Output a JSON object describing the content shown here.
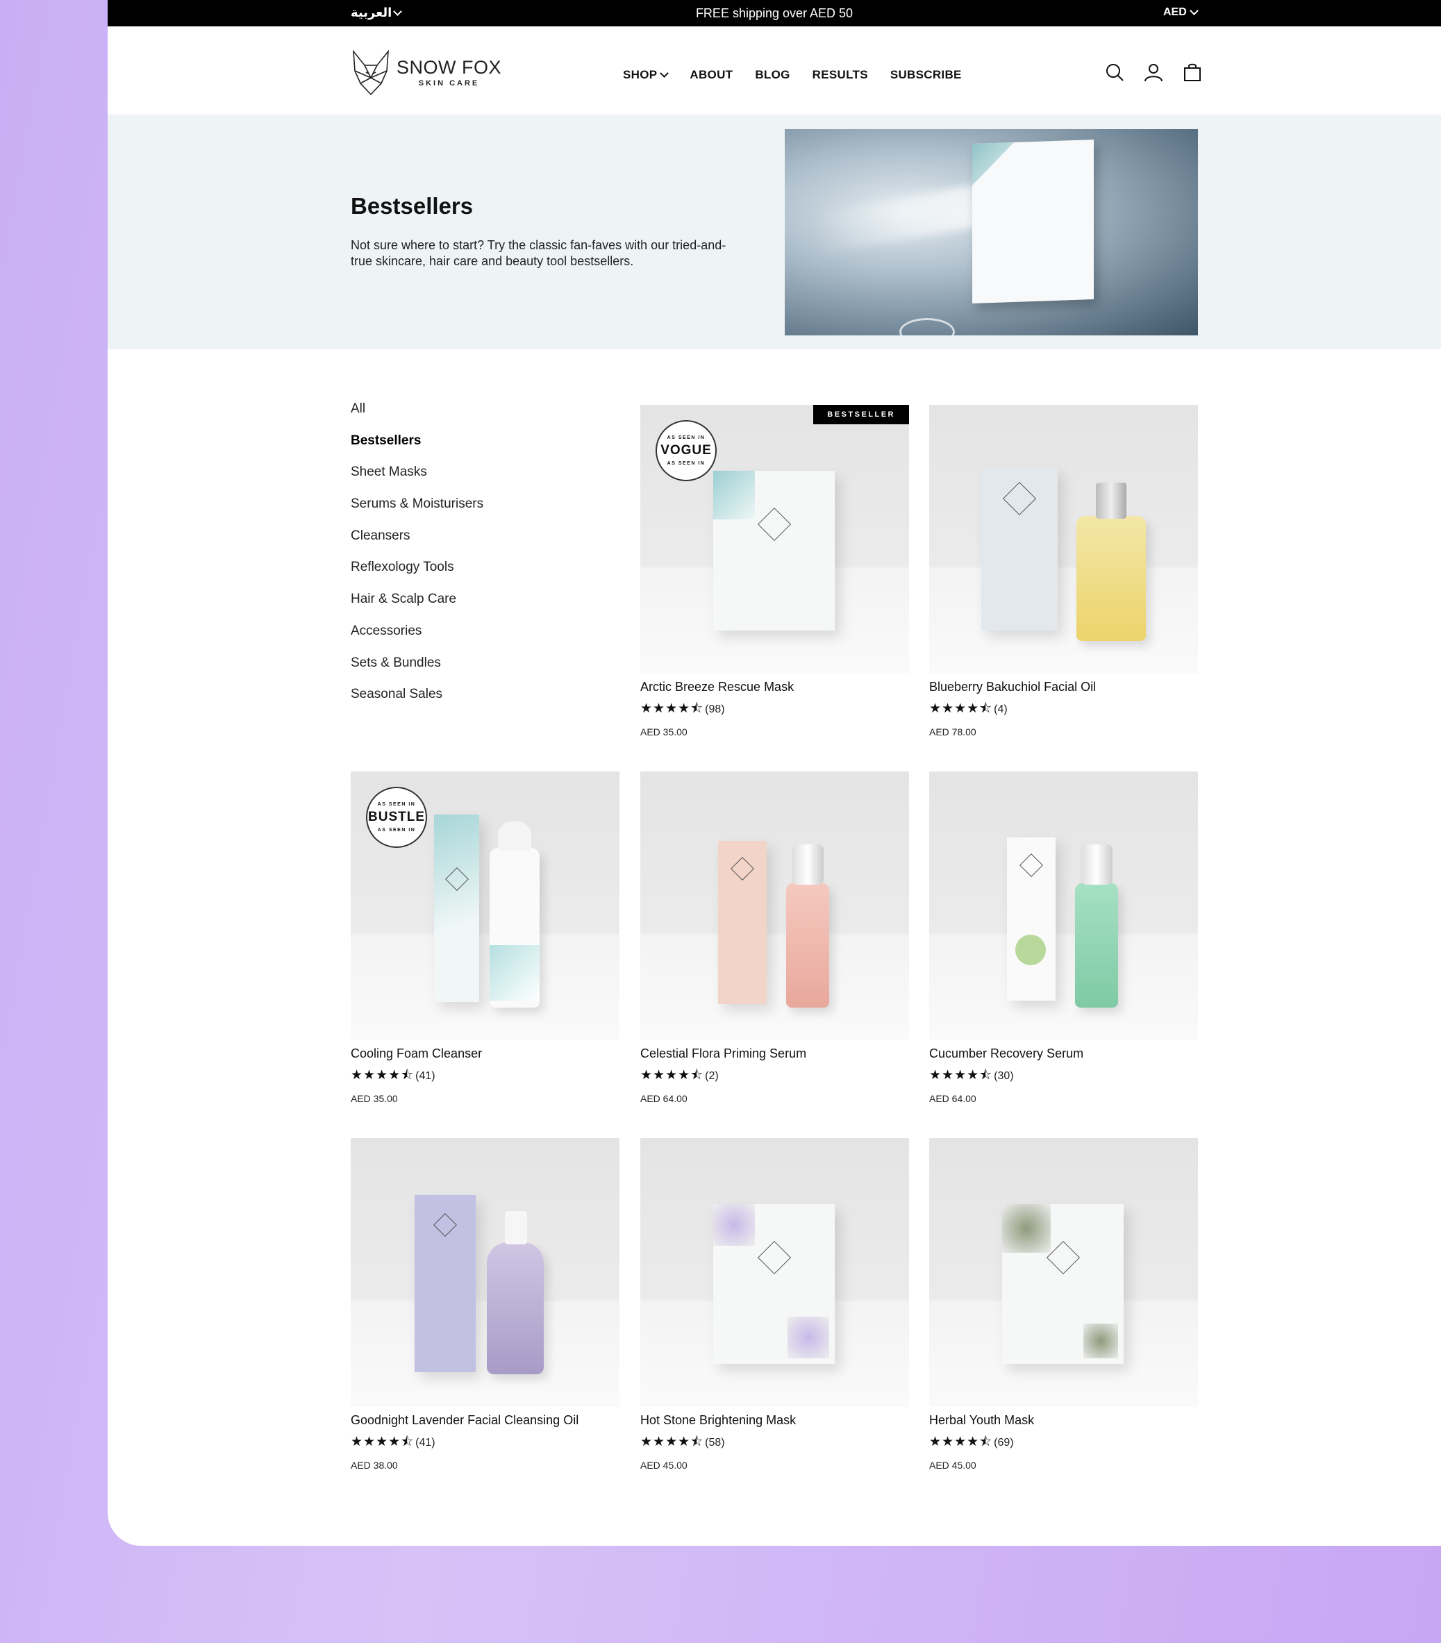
{
  "topbar": {
    "language": "العربية",
    "promo": "FREE shipping over AED 50",
    "currency": "AED"
  },
  "header": {
    "logo_name": "SNOW FOX",
    "logo_sub": "SKIN CARE",
    "nav": [
      "SHOP",
      "ABOUT",
      "BLOG",
      "RESULTS",
      "SUBSCRIBE"
    ]
  },
  "hero": {
    "title": "Bestsellers",
    "description": "Not sure where to start? Try the classic fan-faves with our tried-and-true skincare, hair care and beauty tool bestsellers."
  },
  "sidebar": {
    "items": [
      "All",
      "Bestsellers",
      "Sheet Masks",
      "Serums & Moisturisers",
      "Cleansers",
      "Reflexology Tools",
      "Hair & Scalp Care",
      "Accessories",
      "Sets & Bundles",
      "Seasonal Sales"
    ],
    "active": "Bestsellers"
  },
  "badges": {
    "bestseller": "BESTSELLER",
    "seal_top": "AS SEEN IN",
    "vogue": "VOGUE",
    "bustle": "BUSTLE"
  },
  "products": [
    {
      "name": "Arctic Breeze Rescue Mask",
      "rating_stars": 4.5,
      "reviews": "(98)",
      "price": "AED 35.00"
    },
    {
      "name": "Blueberry Bakuchiol Facial Oil",
      "rating_stars": 4.5,
      "reviews": "(4)",
      "price": "AED 78.00"
    },
    {
      "name": "Cooling Foam Cleanser",
      "rating_stars": 4.5,
      "reviews": "(41)",
      "price": "AED 35.00"
    },
    {
      "name": "Celestial Flora Priming Serum",
      "rating_stars": 4.5,
      "reviews": "(2)",
      "price": "AED 64.00"
    },
    {
      "name": "Cucumber Recovery Serum",
      "rating_stars": 4.5,
      "reviews": "(30)",
      "price": "AED 64.00"
    },
    {
      "name": "Goodnight Lavender Facial Cleansing Oil",
      "rating_stars": 4.5,
      "reviews": "(41)",
      "price": "AED 38.00"
    },
    {
      "name": "Hot Stone Brightening Mask",
      "rating_stars": 4.5,
      "reviews": "(58)",
      "price": "AED 45.00"
    },
    {
      "name": "Herbal Youth Mask",
      "rating_stars": 4.5,
      "reviews": "(69)",
      "price": "AED 45.00"
    }
  ],
  "colors": {
    "accent": "#000000",
    "hero_bg": "#eef4f6",
    "page_bg": "#c9aef5"
  }
}
